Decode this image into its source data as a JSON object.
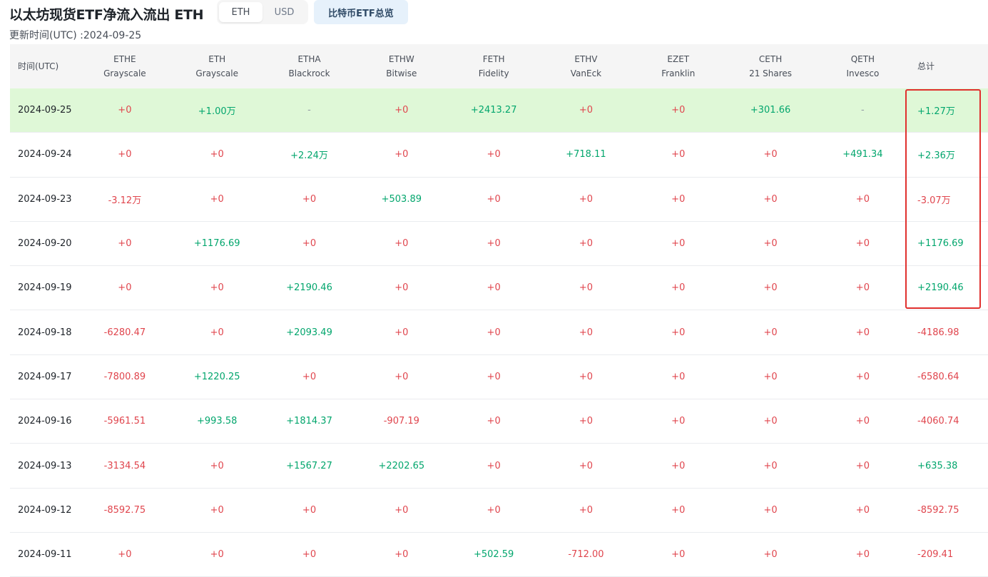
{
  "header": {
    "title": "以太坊现货ETF净流入流出 ETH",
    "unit_options": [
      "ETH",
      "USD"
    ],
    "active_unit": "ETH",
    "overview_button": "比特币ETF总览",
    "updated": "更新时间(UTC) :2024-09-25"
  },
  "colors": {
    "positive": "#03a66d",
    "negative": "#e0454d",
    "highlight_row": "#dff8d7",
    "annotation_box": "#e0302e"
  },
  "table": {
    "date_header": "时间(UTC)",
    "total_header": "总计",
    "columns": [
      {
        "ticker": "ETHE",
        "issuer": "Grayscale"
      },
      {
        "ticker": "ETH",
        "issuer": "Grayscale"
      },
      {
        "ticker": "ETHA",
        "issuer": "Blackrock"
      },
      {
        "ticker": "ETHW",
        "issuer": "Bitwise"
      },
      {
        "ticker": "FETH",
        "issuer": "Fidelity"
      },
      {
        "ticker": "ETHV",
        "issuer": "VanEck"
      },
      {
        "ticker": "EZET",
        "issuer": "Franklin"
      },
      {
        "ticker": "CETH",
        "issuer": "21 Shares"
      },
      {
        "ticker": "QETH",
        "issuer": "Invesco"
      }
    ],
    "rows": [
      {
        "date": "2024-09-25",
        "highlight": true,
        "values": [
          "+0",
          "+1.00万",
          "-",
          "+0",
          "+2413.27",
          "+0",
          "+0",
          "+301.66",
          "-"
        ],
        "total": "+1.27万"
      },
      {
        "date": "2024-09-24",
        "values": [
          "+0",
          "+0",
          "+2.24万",
          "+0",
          "+0",
          "+718.11",
          "+0",
          "+0",
          "+491.34"
        ],
        "total": "+2.36万"
      },
      {
        "date": "2024-09-23",
        "values": [
          "-3.12万",
          "+0",
          "+0",
          "+503.89",
          "+0",
          "+0",
          "+0",
          "+0",
          "+0"
        ],
        "total": "-3.07万"
      },
      {
        "date": "2024-09-20",
        "values": [
          "+0",
          "+1176.69",
          "+0",
          "+0",
          "+0",
          "+0",
          "+0",
          "+0",
          "+0"
        ],
        "total": "+1176.69"
      },
      {
        "date": "2024-09-19",
        "values": [
          "+0",
          "+0",
          "+2190.46",
          "+0",
          "+0",
          "+0",
          "+0",
          "+0",
          "+0"
        ],
        "total": "+2190.46"
      },
      {
        "date": "2024-09-18",
        "values": [
          "-6280.47",
          "+0",
          "+2093.49",
          "+0",
          "+0",
          "+0",
          "+0",
          "+0",
          "+0"
        ],
        "total": "-4186.98"
      },
      {
        "date": "2024-09-17",
        "values": [
          "-7800.89",
          "+1220.25",
          "+0",
          "+0",
          "+0",
          "+0",
          "+0",
          "+0",
          "+0"
        ],
        "total": "-6580.64"
      },
      {
        "date": "2024-09-16",
        "values": [
          "-5961.51",
          "+993.58",
          "+1814.37",
          "-907.19",
          "+0",
          "+0",
          "+0",
          "+0",
          "+0"
        ],
        "total": "-4060.74"
      },
      {
        "date": "2024-09-13",
        "values": [
          "-3134.54",
          "+0",
          "+1567.27",
          "+2202.65",
          "+0",
          "+0",
          "+0",
          "+0",
          "+0"
        ],
        "total": "+635.38"
      },
      {
        "date": "2024-09-12",
        "values": [
          "-8592.75",
          "+0",
          "+0",
          "+0",
          "+0",
          "+0",
          "+0",
          "+0",
          "+0"
        ],
        "total": "-8592.75"
      },
      {
        "date": "2024-09-11",
        "values": [
          "+0",
          "+0",
          "+0",
          "+0",
          "+502.59",
          "-712.00",
          "+0",
          "+0",
          "+0"
        ],
        "total": "-209.41"
      }
    ]
  }
}
